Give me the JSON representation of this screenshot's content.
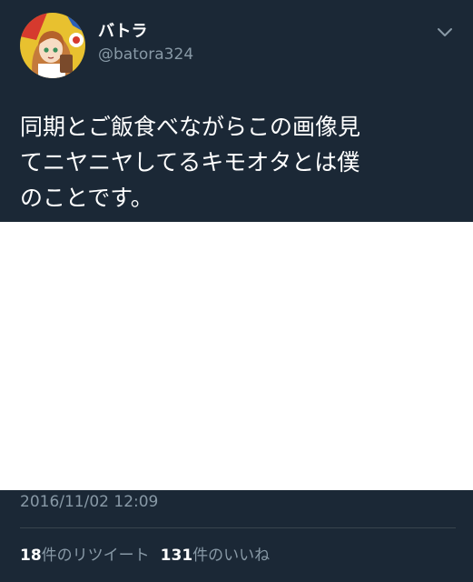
{
  "tweet": {
    "display_name": "バトラ",
    "handle": "@batora324",
    "text_lines": [
      "同期とご飯食べながらこの画像見",
      "てニヤニヤしてるキモオタとは僕",
      "のことです。"
    ],
    "timestamp": "2016/11/02 12:09",
    "retweets": {
      "count": "18",
      "label": "件のリツイート"
    },
    "likes": {
      "count": "131",
      "label": "件のいいね"
    }
  },
  "icons": {
    "menu": "chevron-down-icon",
    "avatar": "avatar"
  },
  "colors": {
    "background": "#1b2836",
    "text_primary": "#ffffff",
    "text_secondary": "#8899a6",
    "divider": "#38444d",
    "media_placeholder": "#ffffff"
  }
}
